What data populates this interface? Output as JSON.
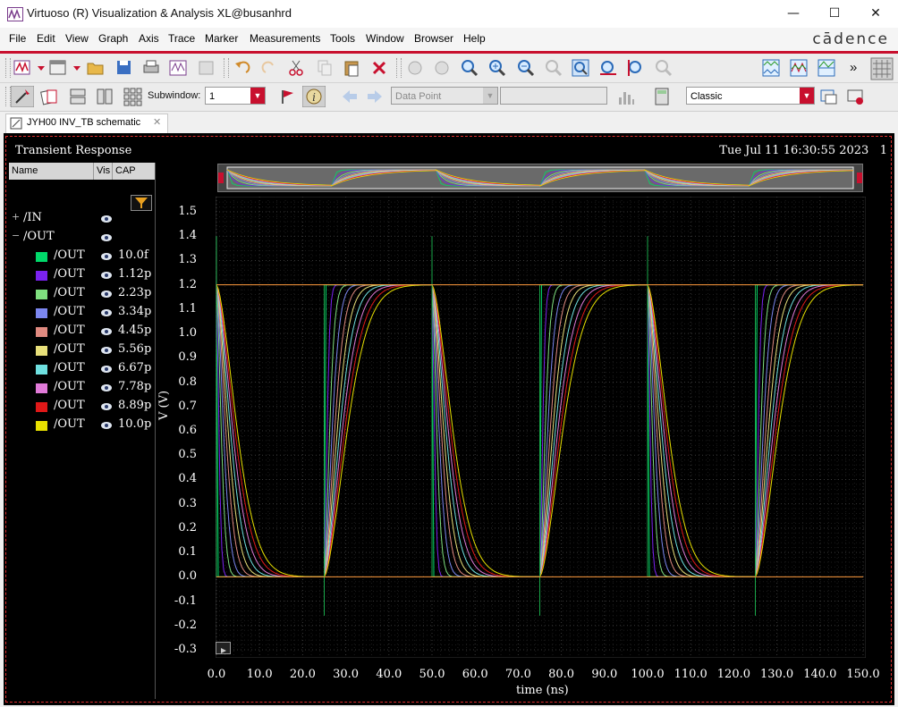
{
  "window": {
    "title": "Virtuoso (R) Visualization & Analysis XL@busanhrd",
    "controls": [
      "—",
      "☐",
      "✕"
    ]
  },
  "menu": {
    "items": [
      "File",
      "Edit",
      "View",
      "Graph",
      "Axis",
      "Trace",
      "Marker",
      "Measurements",
      "Tools",
      "Window",
      "Browser",
      "Help"
    ],
    "brand": "cādence"
  },
  "toolbar": {
    "family_select": "family",
    "subwindow_label": "Subwindow:",
    "subwindow_value": "1",
    "data_point_select": "Data Point",
    "style_select": "Classic",
    "more": "»"
  },
  "tab": {
    "label": "JYH00 INV_TB schematic",
    "close": "✕"
  },
  "plot": {
    "title": "Transient Response",
    "datetime": "Tue Jul 11 16:30:55 2023",
    "datetime_suffix": "1"
  },
  "browser": {
    "headers": [
      "Name",
      "Vis",
      "CAP"
    ],
    "groups": [
      {
        "expander": "+",
        "name": "/IN"
      },
      {
        "expander": "−",
        "name": "/OUT"
      }
    ],
    "traces": [
      {
        "name": "/OUT",
        "cap": "10.0f",
        "color": "#00d96a"
      },
      {
        "name": "/OUT",
        "cap": "1.12p",
        "color": "#7a22f0"
      },
      {
        "name": "/OUT",
        "cap": "2.23p",
        "color": "#7fe07f"
      },
      {
        "name": "/OUT",
        "cap": "3.34p",
        "color": "#7c87f0"
      },
      {
        "name": "/OUT",
        "cap": "4.45p",
        "color": "#e08a80"
      },
      {
        "name": "/OUT",
        "cap": "5.56p",
        "color": "#e8e07a"
      },
      {
        "name": "/OUT",
        "cap": "6.67p",
        "color": "#6fe0e0"
      },
      {
        "name": "/OUT",
        "cap": "7.78p",
        "color": "#e07ad8"
      },
      {
        "name": "/OUT",
        "cap": "8.89p",
        "color": "#e01818"
      },
      {
        "name": "/OUT",
        "cap": "10.0p",
        "color": "#e8e000"
      }
    ]
  },
  "chart_data": {
    "type": "line",
    "title": "Transient Response",
    "xlabel": "time (ns)",
    "ylabel": "V (V)",
    "xlim": [
      0,
      150
    ],
    "ylim": [
      -0.3,
      1.55
    ],
    "x_ticks": [
      "0.0",
      "10.0",
      "20.0",
      "30.0",
      "40.0",
      "50.0",
      "60.0",
      "70.0",
      "80.0",
      "90.0",
      "100.0",
      "110.0",
      "120.0",
      "130.0",
      "140.0",
      "150.0"
    ],
    "y_ticks": [
      "1.5",
      "1.4",
      "1.3",
      "1.2",
      "1.1",
      "1.0",
      "0.9",
      "0.8",
      "0.7",
      "0.6",
      "0.5",
      "0.4",
      "0.3",
      "0.2",
      "0.1",
      "0.0",
      "-0.1",
      "-0.2",
      "-0.3"
    ],
    "input": {
      "name": "/IN",
      "color": "#ff9a3c",
      "low": 0.0,
      "high": 1.2,
      "period_ns": 50,
      "high_intervals_ns": [
        [
          25,
          50
        ],
        [
          75,
          100
        ],
        [
          125,
          150
        ]
      ],
      "spikes_high_ns": [
        0,
        50,
        100
      ],
      "spikes_low_ns": [
        25,
        75,
        125
      ],
      "spike_high_value": 1.4,
      "spike_low_value": -0.16
    },
    "series": [
      {
        "name": "/OUT",
        "cap": "10.0f",
        "fall_time_ns": 0.1,
        "rise_time_ns": 0.1
      },
      {
        "name": "/OUT",
        "cap": "1.12p",
        "fall_time_ns": 1.2,
        "rise_time_ns": 1.4
      },
      {
        "name": "/OUT",
        "cap": "2.23p",
        "fall_time_ns": 2.3,
        "rise_time_ns": 2.6
      },
      {
        "name": "/OUT",
        "cap": "3.34p",
        "fall_time_ns": 3.4,
        "rise_time_ns": 3.8
      },
      {
        "name": "/OUT",
        "cap": "4.45p",
        "fall_time_ns": 4.5,
        "rise_time_ns": 5.0
      },
      {
        "name": "/OUT",
        "cap": "5.56p",
        "fall_time_ns": 5.6,
        "rise_time_ns": 6.2
      },
      {
        "name": "/OUT",
        "cap": "6.67p",
        "fall_time_ns": 6.7,
        "rise_time_ns": 7.4
      },
      {
        "name": "/OUT",
        "cap": "7.78p",
        "fall_time_ns": 7.8,
        "rise_time_ns": 8.6
      },
      {
        "name": "/OUT",
        "cap": "8.89p",
        "fall_time_ns": 8.9,
        "rise_time_ns": 9.8
      },
      {
        "name": "/OUT",
        "cap": "10.0p",
        "fall_time_ns": 10.0,
        "rise_time_ns": 11.0
      }
    ],
    "grid": true,
    "legend": "left-browser"
  }
}
